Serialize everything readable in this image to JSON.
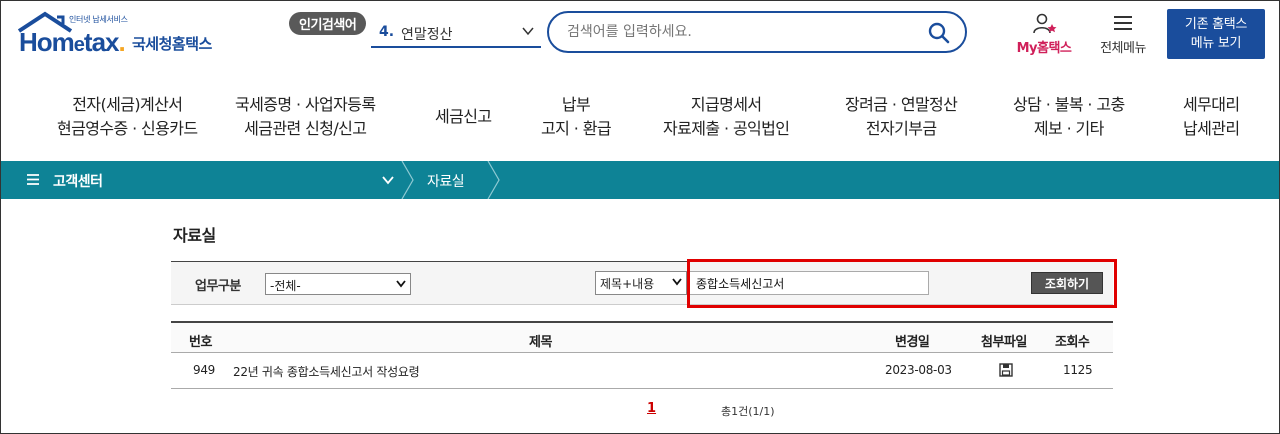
{
  "header": {
    "logo_small": "인터넷 납세서비스",
    "logo_home": "Hom",
    "logo_e": "e",
    "logo_tax": "tax",
    "logo_dot": ".",
    "logo_name": "국세청홈택스",
    "hot_badge": "인기검색어",
    "hot_num": "4.",
    "hot_keyword": "연말정산",
    "search_placeholder": "검색어를 입력하세요.",
    "my_tax": "My홈택스",
    "all_menu": "전체메뉴",
    "old_btn_line1": "기존 홈택스",
    "old_btn_line2": "메뉴 보기"
  },
  "gnb": [
    {
      "l1": "전자(세금)계산서",
      "l2": "현금영수증 · 신용카드"
    },
    {
      "l1": "국세증명 · 사업자등록",
      "l2": "세금관련 신청/신고"
    },
    {
      "l1": "세금신고",
      "l2": ""
    },
    {
      "l1": "납부",
      "l2": "고지 · 환급"
    },
    {
      "l1": "지급명세서",
      "l2": "자료제출 · 공익법인"
    },
    {
      "l1": "장려금 · 연말정산",
      "l2": "전자기부금"
    },
    {
      "l1": "상담 · 불복 · 고충",
      "l2": "제보 · 기타"
    },
    {
      "l1": "세무대리",
      "l2": "납세관리"
    }
  ],
  "breadcrumb": {
    "root": "고객센터",
    "current": "자료실"
  },
  "page_title": "자료실",
  "filter": {
    "label": "업무구분",
    "category_selected": "-전체-",
    "field_selected": "제목+내용",
    "keyword": "종합소득세신고서",
    "query_btn": "조회하기"
  },
  "table": {
    "headers": {
      "no": "번호",
      "title": "제목",
      "date": "변경일",
      "file": "첨부파일",
      "views": "조회수"
    },
    "rows": [
      {
        "no": "949",
        "title": "22년 귀속 종합소득세신고서 작성요령",
        "date": "2023-08-03",
        "views": "1125"
      }
    ]
  },
  "pager": {
    "page": "1",
    "total": "총1건(1/1)"
  },
  "colors": {
    "brand": "#1a4d9c",
    "crumb_bar": "#0e8396",
    "highlight": "#e00000",
    "my_tax": "#d0205a"
  }
}
